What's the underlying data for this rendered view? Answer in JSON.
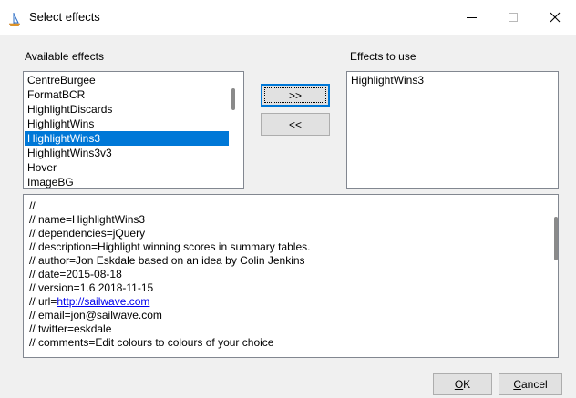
{
  "window": {
    "title": "Select effects",
    "icon": "sailboat-icon"
  },
  "available": {
    "label": "Available effects",
    "items": [
      "CentreBurgee",
      "FormatBCR",
      "HighlightDiscards",
      "HighlightWins",
      "HighlightWins3",
      "HighlightWins3v3",
      "Hover",
      "ImageBG"
    ],
    "selected_index": 4
  },
  "to_use": {
    "label": "Effects to use",
    "items": [
      "HighlightWins3"
    ]
  },
  "buttons": {
    "add": ">>",
    "remove": "<<",
    "ok_key": "O",
    "ok_rest": "K",
    "cancel_key": "C",
    "cancel_rest": "ancel"
  },
  "script": {
    "lines": [
      "//",
      "// name=HighlightWins3",
      "// dependencies=jQuery",
      "// description=Highlight winning scores in summary tables.",
      "// author=Jon Eskdale based on an idea by Colin Jenkins",
      "// date=2015-08-18",
      "// version=1.6 2018-11-15",
      "// url=",
      "// email=jon@sailwave.com",
      "// twitter=eskdale",
      "// comments=Edit colours to colours of your choice"
    ],
    "url_link": "http://sailwave.com"
  },
  "colors": {
    "selection": "#0078d7",
    "link": "#0000ee"
  }
}
